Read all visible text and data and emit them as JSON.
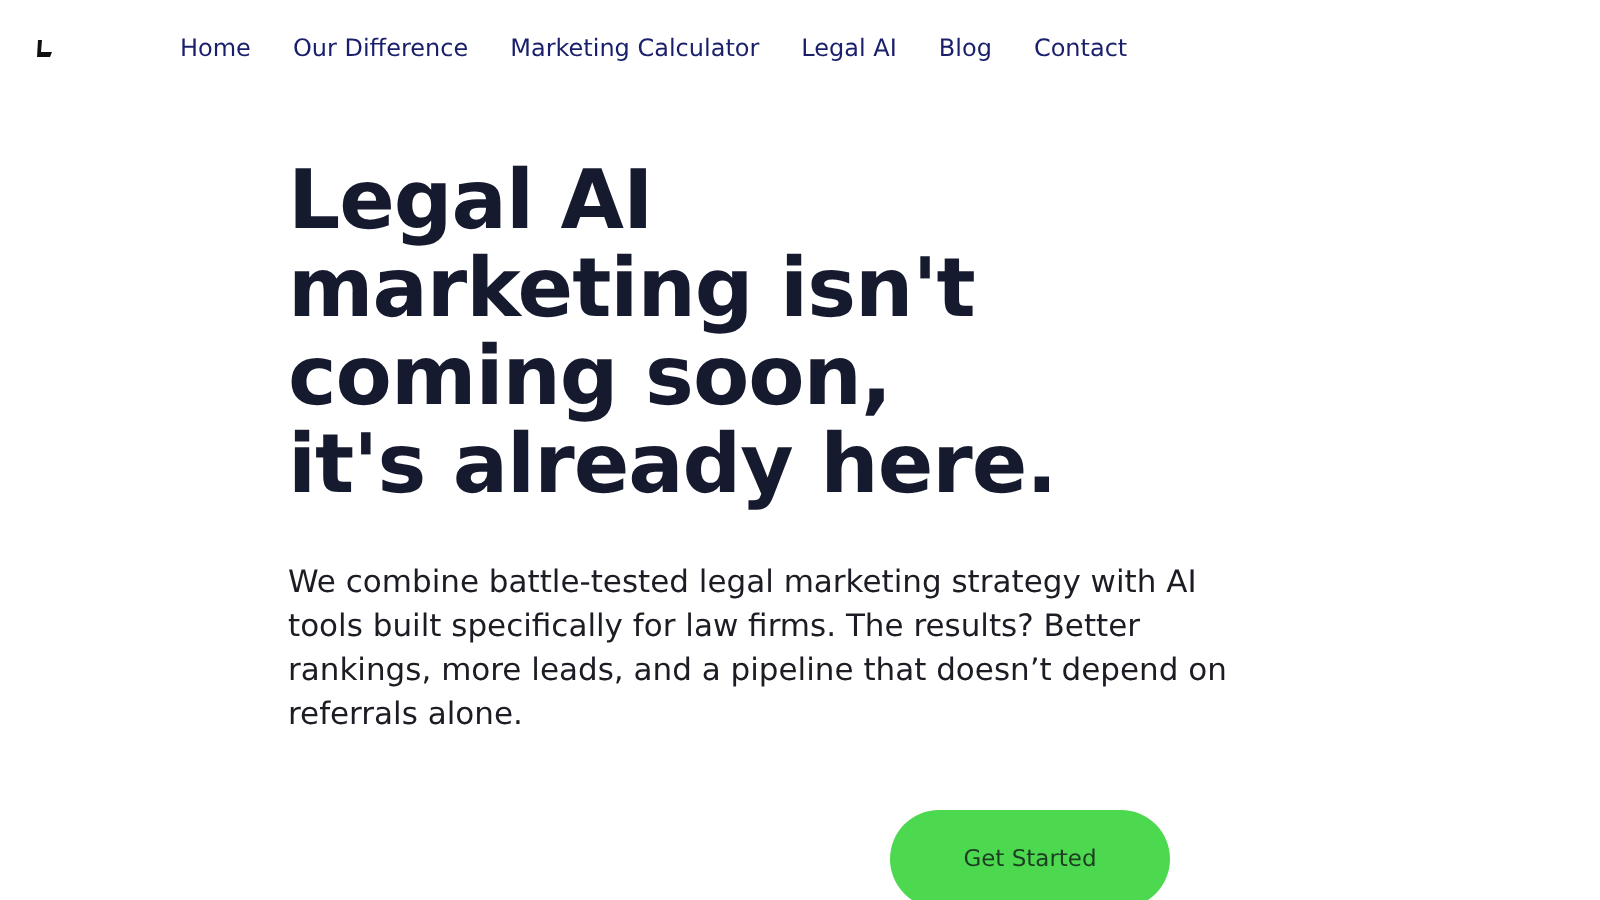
{
  "nav": {
    "items": [
      {
        "label": "Home"
      },
      {
        "label": "Our Difference"
      },
      {
        "label": "Marketing Calculator"
      },
      {
        "label": "Legal AI"
      },
      {
        "label": "Blog"
      },
      {
        "label": "Contact"
      }
    ]
  },
  "hero": {
    "headline_lines": [
      "Legal AI",
      "marketing isn't",
      "coming soon,",
      "it's already here."
    ],
    "body": "We combine battle-tested legal marketing strategy with AI tools built specifically for law firms. The results? Better rankings, more leads, and a pipeline that doesn’t depend on referrals alone.",
    "button": "Get Started"
  }
}
